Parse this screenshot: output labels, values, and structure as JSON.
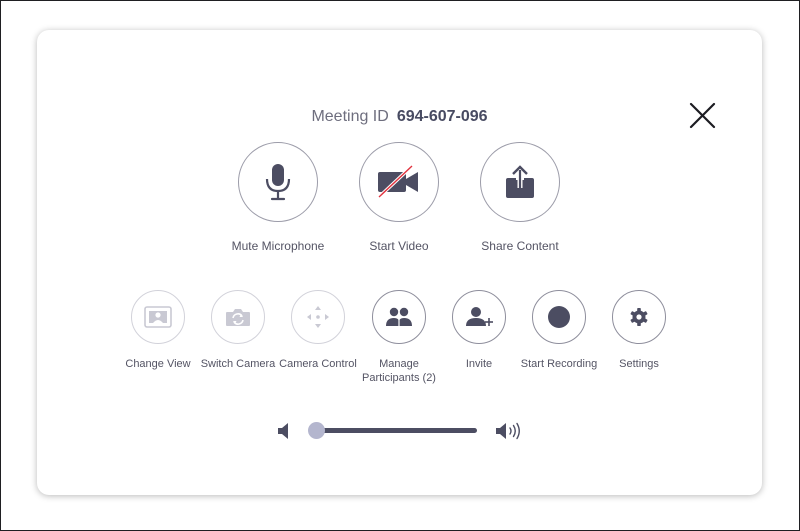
{
  "meeting": {
    "id_label": "Meeting ID",
    "id_value": "694-607-096"
  },
  "close": {
    "icon": "close-icon"
  },
  "primary_actions": [
    {
      "label": "Mute Microphone",
      "icon": "microphone-icon"
    },
    {
      "label": "Start Video",
      "icon": "video-off-icon"
    },
    {
      "label": "Share Content",
      "icon": "share-icon"
    }
  ],
  "secondary_actions": [
    {
      "label": "Change View",
      "icon": "change-view-icon",
      "enabled": false
    },
    {
      "label": "Switch Camera",
      "icon": "switch-camera-icon",
      "enabled": false
    },
    {
      "label": "Camera Control",
      "icon": "camera-control-icon",
      "enabled": false
    },
    {
      "label_line1": "Manage",
      "label_line2": "Participants (2)",
      "icon": "participants-icon",
      "enabled": true
    },
    {
      "label": "Invite",
      "icon": "invite-icon",
      "enabled": true
    },
    {
      "label": "Start Recording",
      "icon": "record-icon",
      "enabled": true
    },
    {
      "label": "Settings",
      "icon": "gear-icon",
      "enabled": true
    }
  ],
  "volume": {
    "level": 0,
    "min_icon": "volume-low-icon",
    "max_icon": "volume-high-icon"
  },
  "colors": {
    "icon": "#4c4d62",
    "disabled_icon": "#c9c9d3",
    "accent_red": "#e0323e",
    "slider_thumb": "#b4b6ce"
  }
}
